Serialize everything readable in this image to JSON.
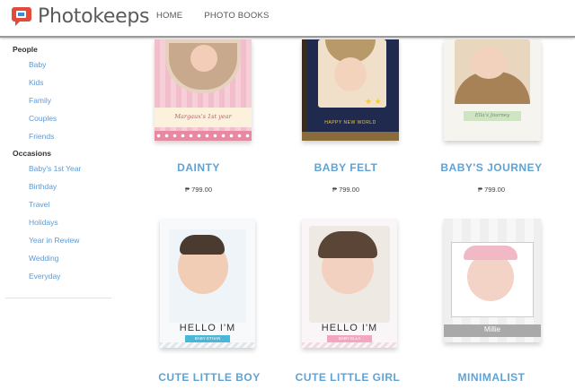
{
  "header": {
    "logo_text": "Photokeeps",
    "nav": [
      "HOME",
      "PHOTO BOOKS"
    ]
  },
  "sidebar": {
    "groups": [
      {
        "heading": "People",
        "items": [
          "Baby",
          "Kids",
          "Family",
          "Couples",
          "Friends"
        ]
      },
      {
        "heading": "Occasions",
        "items": [
          "Baby's 1st Year",
          "Birthday",
          "Travel",
          "Holidays",
          "Year in Review",
          "Wedding",
          "Everyday"
        ]
      }
    ]
  },
  "products": [
    {
      "title": "DAINTY",
      "price": "₱ 799.00",
      "cover_text": "Margaux's 1st year"
    },
    {
      "title": "BABY FELT",
      "price": "₱ 799.00",
      "cover_text": "HAPPY NEW WORLD"
    },
    {
      "title": "BABY'S JOURNEY",
      "price": "₱ 799.00",
      "cover_text": "Ella's Journey"
    },
    {
      "title": "CUTE LITTLE BOY",
      "price": "",
      "cover_text": "HELLO I'M",
      "cover_sub": "BABY ETHAN"
    },
    {
      "title": "CUTE LITTLE GIRL",
      "price": "",
      "cover_text": "HELLO I'M",
      "cover_sub": "BABY ELLA"
    },
    {
      "title": "MINIMALIST",
      "price": "",
      "cover_text": "Millie"
    }
  ],
  "colors": {
    "accent": "#5fa3d4",
    "link": "#5a9ad6",
    "logo_red": "#e24b3b",
    "logo_blue": "#3a8ed0"
  },
  "icons": {
    "logo": "photo-speech-bubble-icon"
  }
}
